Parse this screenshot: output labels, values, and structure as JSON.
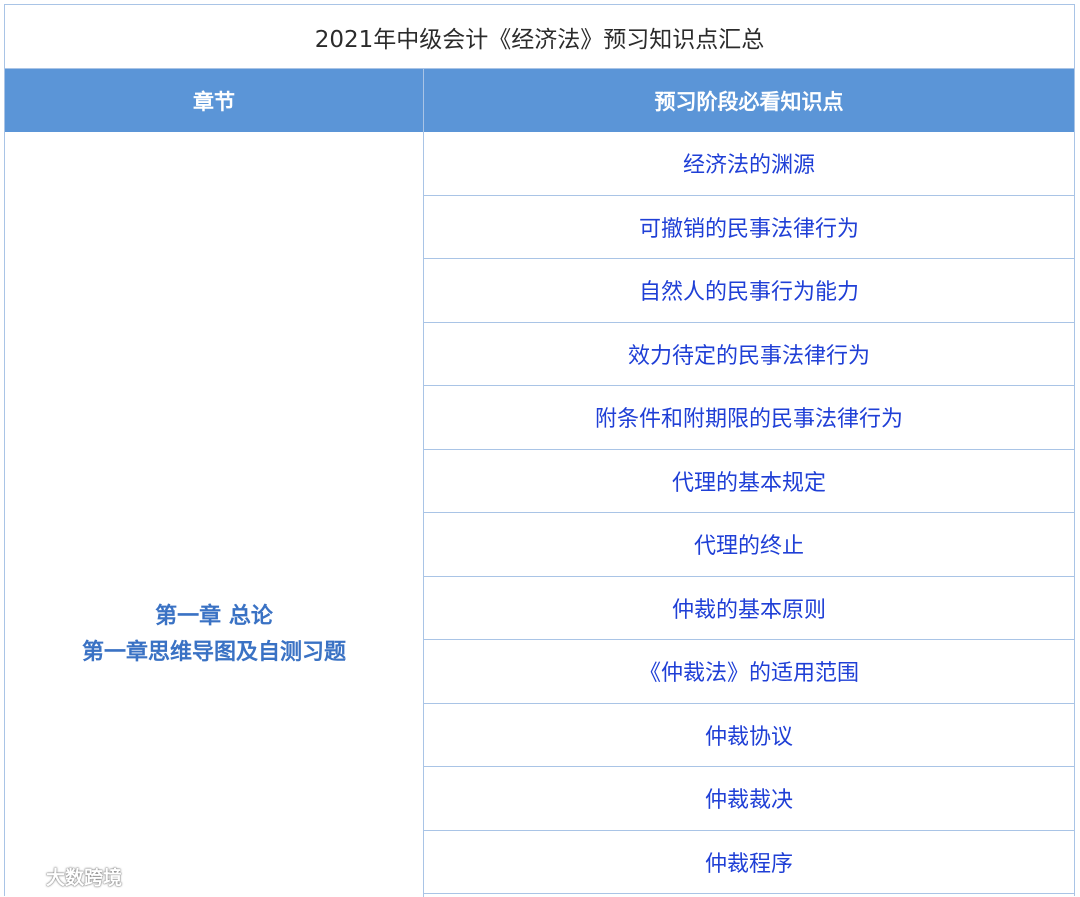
{
  "table": {
    "title": "2021年中级会计《经济法》预习知识点汇总",
    "headers": {
      "chapter": "章节",
      "points": "预习阶段必看知识点"
    },
    "chapter": {
      "line1": "第一章 总论",
      "line2": "第一章思维导图及自测习题"
    },
    "points": [
      "经济法的渊源",
      "可撤销的民事法律行为",
      "自然人的民事行为能力",
      "效力待定的民事法律行为",
      "附条件和附期限的民事法律行为",
      "代理的基本规定",
      "代理的终止",
      "仲裁的基本原则",
      "《仲裁法》的适用范围",
      "仲裁协议",
      "仲裁裁决",
      "仲裁程序"
    ]
  },
  "watermark": {
    "text": "大数跨境"
  },
  "colors": {
    "header_bg": "#5b95d7",
    "border": "#a9c4e6",
    "chapter_text": "#3a72c4",
    "point_text": "#1f3fd6"
  }
}
